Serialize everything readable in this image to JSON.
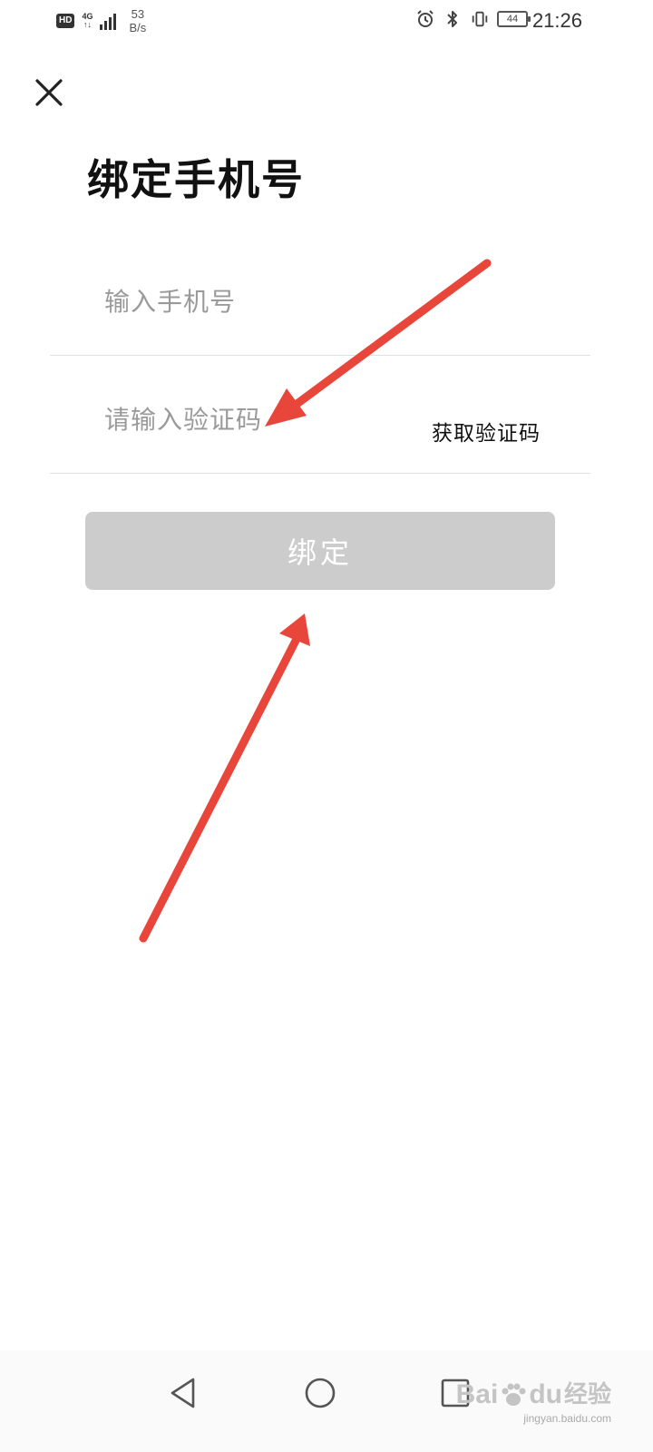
{
  "status_bar": {
    "hd": "HD",
    "network": "4G",
    "speed_value": "53",
    "speed_unit": "B/s",
    "battery": "44",
    "time": "21:26"
  },
  "header": {
    "close_icon": "close-icon",
    "title": "绑定手机号"
  },
  "form": {
    "phone_placeholder": "输入手机号",
    "code_placeholder": "请输入验证码",
    "get_code_label": "获取验证码",
    "submit_label": "绑定",
    "submit_color": "#cccccc"
  },
  "annotation": {
    "arrow_color": "#e8463a"
  },
  "navigation": {
    "back_icon": "triangle-back-icon",
    "home_icon": "circle-home-icon",
    "recent_icon": "square-recent-icon"
  },
  "watermark": {
    "brand_text": "Bai",
    "brand_text2": "du",
    "brand_suffix": "经验",
    "sub": "jingyan.baidu.com"
  }
}
